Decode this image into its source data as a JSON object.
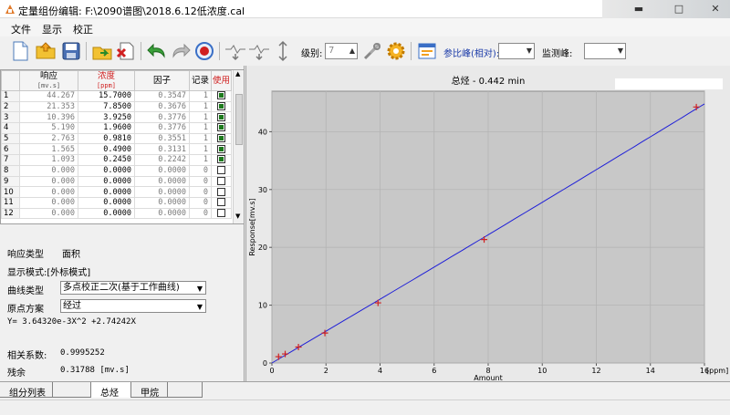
{
  "window": {
    "title": "定量组份编辑: F:\\2090谱图\\2018.6.12低浓度.cal"
  },
  "menu": {
    "items": [
      "文件",
      "显示",
      "校正"
    ]
  },
  "toolbar": {
    "level_label": "级别:",
    "level_value": "7",
    "ref_peak_label": "参比峰(相对):",
    "ref_peak_value": "",
    "monitor_peak_label": "监测峰:",
    "monitor_peak_value": ""
  },
  "table": {
    "headers": [
      {
        "label": "响应",
        "unit": "[mv.s]"
      },
      {
        "label": "浓度",
        "unit": "[ppm]"
      },
      {
        "label": "因子",
        "unit": ""
      },
      {
        "label": "记录",
        "unit": ""
      },
      {
        "label": "使用",
        "unit": ""
      }
    ],
    "rows": [
      {
        "n": "1",
        "resp": "44.267",
        "conc": "15.7000",
        "factor": "0.3547",
        "rec": "1",
        "use": true
      },
      {
        "n": "2",
        "resp": "21.353",
        "conc": "7.8500",
        "factor": "0.3676",
        "rec": "1",
        "use": true
      },
      {
        "n": "3",
        "resp": "10.396",
        "conc": "3.9250",
        "factor": "0.3776",
        "rec": "1",
        "use": true
      },
      {
        "n": "4",
        "resp": "5.190",
        "conc": "1.9600",
        "factor": "0.3776",
        "rec": "1",
        "use": true
      },
      {
        "n": "5",
        "resp": "2.763",
        "conc": "0.9810",
        "factor": "0.3551",
        "rec": "1",
        "use": true
      },
      {
        "n": "6",
        "resp": "1.565",
        "conc": "0.4900",
        "factor": "0.3131",
        "rec": "1",
        "use": true
      },
      {
        "n": "7",
        "resp": "1.093",
        "conc": "0.2450",
        "factor": "0.2242",
        "rec": "1",
        "use": true
      },
      {
        "n": "8",
        "resp": "0.000",
        "conc": "0.0000",
        "factor": "0.0000",
        "rec": "0",
        "use": false
      },
      {
        "n": "9",
        "resp": "0.000",
        "conc": "0.0000",
        "factor": "0.0000",
        "rec": "0",
        "use": false
      },
      {
        "n": "10",
        "resp": "0.000",
        "conc": "0.0000",
        "factor": "0.0000",
        "rec": "0",
        "use": false
      },
      {
        "n": "11",
        "resp": "0.000",
        "conc": "0.0000",
        "factor": "0.0000",
        "rec": "0",
        "use": false
      },
      {
        "n": "12",
        "resp": "0.000",
        "conc": "0.0000",
        "factor": "0.0000",
        "rec": "0",
        "use": false
      }
    ]
  },
  "props": {
    "response_type_label": "响应类型",
    "response_type_value": "面积",
    "display_mode": "显示模式:[外标模式]",
    "curve_type_label": "曲线类型",
    "curve_type_value": "多点校正二次(基于工作曲线)",
    "origin_label": "原点方案",
    "origin_value": "经过",
    "equation": "Y= 3.64320e-3X^2 +2.74242X",
    "corr_label": "相关系数:",
    "corr_value": "0.9995252",
    "resid_label": "残余",
    "resid_value": "0.31788 [mv.s]"
  },
  "tabs": [
    {
      "label": "组分列表"
    },
    {
      "label": ""
    },
    {
      "label": "总烃"
    },
    {
      "label": "甲烷"
    },
    {
      "label": ""
    }
  ],
  "chart_data": {
    "type": "scatter",
    "title": "总烃 - 0.442 min",
    "xlabel": "Amount",
    "ylabel": "Response[mv.s]",
    "x_unit": "[ppm]",
    "xlim": [
      0,
      16
    ],
    "ylim": [
      0,
      47
    ],
    "xticks": [
      0,
      2,
      4,
      6,
      8,
      10,
      12,
      14,
      16
    ],
    "yticks": [
      0,
      10,
      20,
      30,
      40
    ],
    "grid": true,
    "points": [
      {
        "x": 0.245,
        "y": 1.093
      },
      {
        "x": 0.49,
        "y": 1.565
      },
      {
        "x": 0.981,
        "y": 2.763
      },
      {
        "x": 1.96,
        "y": 5.19
      },
      {
        "x": 3.925,
        "y": 10.396
      },
      {
        "x": 7.85,
        "y": 21.353
      },
      {
        "x": 15.7,
        "y": 44.267
      }
    ],
    "fit": {
      "a": 0.0036432,
      "b": 2.74242,
      "c": 0
    },
    "colors": {
      "points": "#d02020",
      "line": "#1f1fd8",
      "plot_bg": "#c8c8c8"
    }
  }
}
